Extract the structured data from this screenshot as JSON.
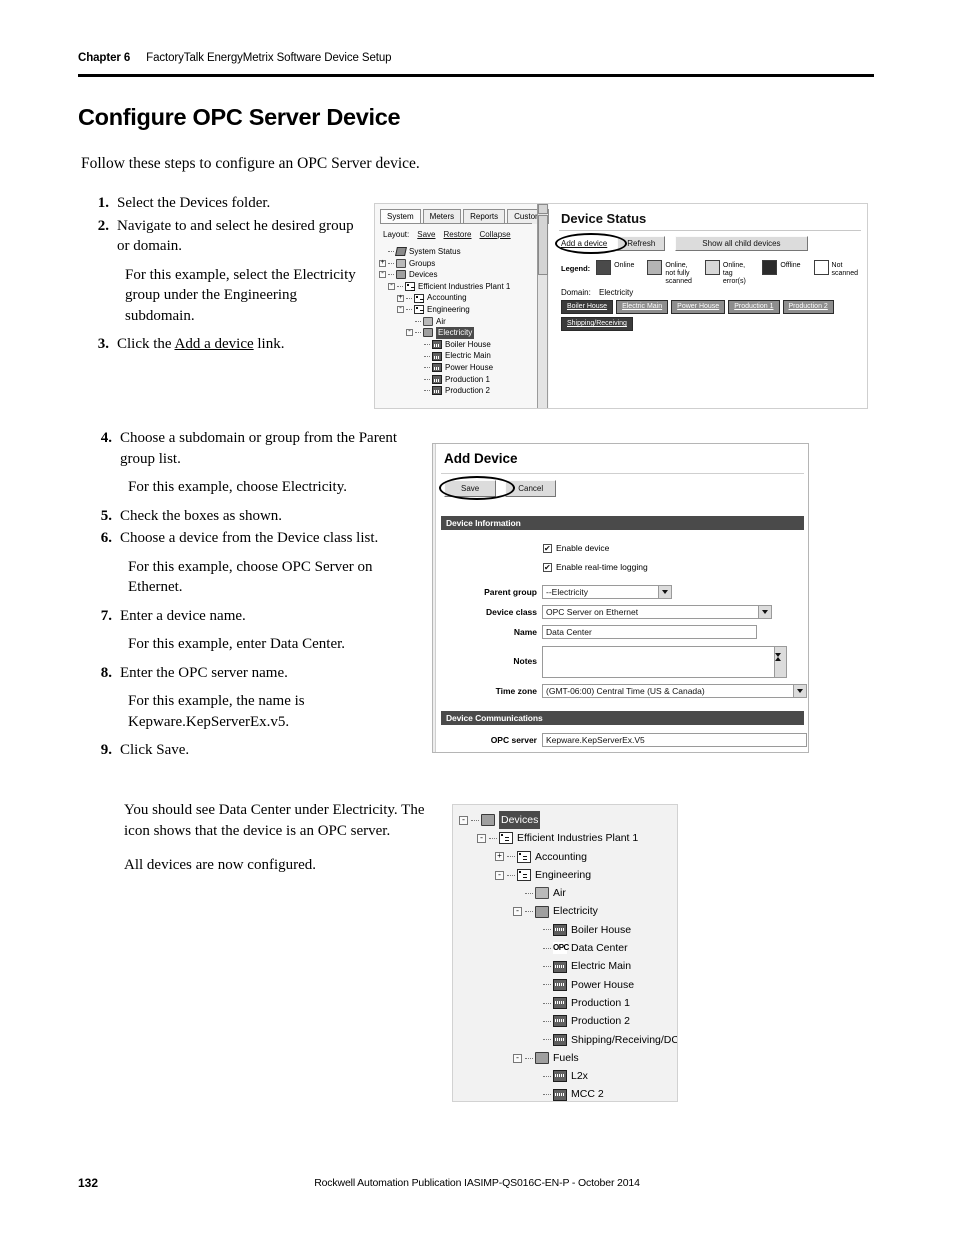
{
  "header": {
    "chapter": "Chapter 6",
    "chapter_title": "FactoryTalk EnergyMetrix Software Device Setup"
  },
  "section_title": "Configure OPC Server Device",
  "intro": "Follow these steps to configure an OPC Server device.",
  "steps_a": [
    {
      "num": "1.",
      "text": "Select the Devices folder."
    },
    {
      "num": "2.",
      "text": "Navigate to and select he desired group or domain."
    }
  ],
  "note_a": "For this example, select the Electricity group under the Engineering subdomain.",
  "step_3": {
    "num": "3.",
    "pre": "Click the ",
    "link": "Add a device",
    "post": " link."
  },
  "steps_b": [
    {
      "num": "4.",
      "text": "Choose a subdomain or group from the Parent group list."
    },
    {
      "num": "5.",
      "text": "Check the boxes as shown."
    },
    {
      "num": "6.",
      "text": "Choose a device from the Device class list."
    },
    {
      "num": "7.",
      "text": "Enter a device name."
    },
    {
      "num": "8.",
      "text": "Enter the OPC server name."
    },
    {
      "num": "9.",
      "text": "Click Save."
    }
  ],
  "notes_b": {
    "after4": "For this example, choose Electricity.",
    "after6": "For this example, choose OPC Server on Ethernet.",
    "after7": "For this example, enter Data Center.",
    "after8": "For this example, the name is Kepware.KepServerEx.v5."
  },
  "closing": {
    "p1": "You should see Data Center under Electricity. The icon shows that the device is an OPC server.",
    "p2": "All devices are now configured."
  },
  "footer": {
    "page_number": "132",
    "publication": "Rockwell Automation Publication IASIMP-QS016C-EN-P - October 2014"
  },
  "shot1": {
    "tabs": [
      "System",
      "Meters",
      "Reports",
      "Custom"
    ],
    "active_tab": "System",
    "layout_label": "Layout:",
    "layout_links": [
      "Save",
      "Restore",
      "Collapse"
    ],
    "tree": [
      {
        "label": "System Status",
        "depth": 0,
        "toggle": "none",
        "icon": "status-icon",
        "selected": false
      },
      {
        "label": "Groups",
        "depth": 0,
        "toggle": "+",
        "icon": "folder-icon",
        "selected": false
      },
      {
        "label": "Devices",
        "depth": 0,
        "toggle": "-",
        "icon": "folder-open-icon",
        "selected": false
      },
      {
        "label": "Efficient Industries Plant 1",
        "depth": 1,
        "toggle": "-",
        "icon": "domain-icon",
        "selected": false
      },
      {
        "label": "Accounting",
        "depth": 2,
        "toggle": "+",
        "icon": "domain-icon",
        "selected": false
      },
      {
        "label": "Engineering",
        "depth": 2,
        "toggle": "-",
        "icon": "domain-icon",
        "selected": false
      },
      {
        "label": "Air",
        "depth": 3,
        "toggle": "none",
        "icon": "folder-icon",
        "selected": false
      },
      {
        "label": "Electricity",
        "depth": 3,
        "toggle": "-",
        "icon": "folder-open-icon",
        "selected": true
      },
      {
        "label": "Boiler House",
        "depth": 4,
        "toggle": "none",
        "icon": "meter-icon",
        "selected": false
      },
      {
        "label": "Electric Main",
        "depth": 4,
        "toggle": "none",
        "icon": "meter-icon",
        "selected": false
      },
      {
        "label": "Power House",
        "depth": 4,
        "toggle": "none",
        "icon": "meter-icon",
        "selected": false
      },
      {
        "label": "Production 1",
        "depth": 4,
        "toggle": "none",
        "icon": "meter-icon",
        "selected": false
      },
      {
        "label": "Production 2",
        "depth": 4,
        "toggle": "none",
        "icon": "meter-icon",
        "selected": false
      }
    ],
    "panel_title": "Device Status",
    "toolbar": {
      "add_device_link": "Add a device",
      "refresh_button": "Refresh",
      "show_all_button": "Show all child devices"
    },
    "legend_label": "Legend:",
    "legend": [
      {
        "label": "Online",
        "color": "#4a4a4a"
      },
      {
        "label": "Online, not fully scanned",
        "color": "#b4b4b4"
      },
      {
        "label": "Online, tag error(s)",
        "color": "#d8d8d8"
      },
      {
        "label": "Offline",
        "color": "#2b2b2b"
      },
      {
        "label": "Not scanned",
        "color": "#ffffff"
      }
    ],
    "domain_label": "Domain:",
    "domain_value": "Electricity",
    "device_buttons": [
      {
        "label": "Boiler House",
        "shade": "dark"
      },
      {
        "label": "Electric Main",
        "shade": "mid"
      },
      {
        "label": "Power House",
        "shade": "mid"
      },
      {
        "label": "Production 1",
        "shade": "mid"
      },
      {
        "label": "Production 2",
        "shade": "mid"
      },
      {
        "label": "Shipping/Receiving",
        "shade": "dark"
      }
    ]
  },
  "shot2": {
    "title": "Add Device",
    "save_button": "Save",
    "cancel_button": "Cancel",
    "section_device_information": "Device Information",
    "section_device_communications": "Device Communications",
    "enable_device_label": "Enable device",
    "enable_device_checked": true,
    "enable_logging_label": "Enable real-time logging",
    "enable_logging_checked": true,
    "parent_group_label": "Parent group",
    "parent_group_value": "--Electricity",
    "device_class_label": "Device class",
    "device_class_value": "OPC Server on Ethernet",
    "name_label": "Name",
    "name_value": "Data Center",
    "notes_label": "Notes",
    "notes_value": "",
    "timezone_label": "Time zone",
    "timezone_value": "(GMT-06:00) Central Time (US & Canada)",
    "opc_server_label": "OPC server",
    "opc_server_value": "Kepware.KepServerEx.V5"
  },
  "shot3": {
    "tree": [
      {
        "label": "Devices",
        "depth": 0,
        "toggle": "-",
        "icon": "folder-open-icon",
        "selected": true
      },
      {
        "label": "Efficient Industries Plant 1",
        "depth": 1,
        "toggle": "-",
        "icon": "domain-icon",
        "selected": false
      },
      {
        "label": "Accounting",
        "depth": 2,
        "toggle": "+",
        "icon": "domain-icon",
        "selected": false
      },
      {
        "label": "Engineering",
        "depth": 2,
        "toggle": "-",
        "icon": "domain-icon",
        "selected": false
      },
      {
        "label": "Air",
        "depth": 3,
        "toggle": "none",
        "icon": "folder-icon",
        "selected": false
      },
      {
        "label": "Electricity",
        "depth": 3,
        "toggle": "-",
        "icon": "folder-open-icon",
        "selected": false
      },
      {
        "label": "Boiler House",
        "depth": 4,
        "toggle": "none",
        "icon": "meter-icon",
        "selected": false
      },
      {
        "label": "Data Center",
        "depth": 4,
        "toggle": "none",
        "icon": "opc-icon",
        "selected": false
      },
      {
        "label": "Electric Main",
        "depth": 4,
        "toggle": "none",
        "icon": "meter-icon",
        "selected": false
      },
      {
        "label": "Power House",
        "depth": 4,
        "toggle": "none",
        "icon": "meter-icon",
        "selected": false
      },
      {
        "label": "Production 1",
        "depth": 4,
        "toggle": "none",
        "icon": "meter-icon",
        "selected": false
      },
      {
        "label": "Production 2",
        "depth": 4,
        "toggle": "none",
        "icon": "meter-icon",
        "selected": false
      },
      {
        "label": "Shipping/Receiving/DC",
        "depth": 4,
        "toggle": "none",
        "icon": "meter-icon",
        "selected": false
      },
      {
        "label": "Fuels",
        "depth": 3,
        "toggle": "-",
        "icon": "folder-open-icon",
        "selected": false
      },
      {
        "label": "L2x",
        "depth": 4,
        "toggle": "none",
        "icon": "meter-icon",
        "selected": false
      },
      {
        "label": "MCC 2",
        "depth": 4,
        "toggle": "none",
        "icon": "meter-icon",
        "selected": false
      }
    ],
    "opc_icon_text": "OPC"
  }
}
